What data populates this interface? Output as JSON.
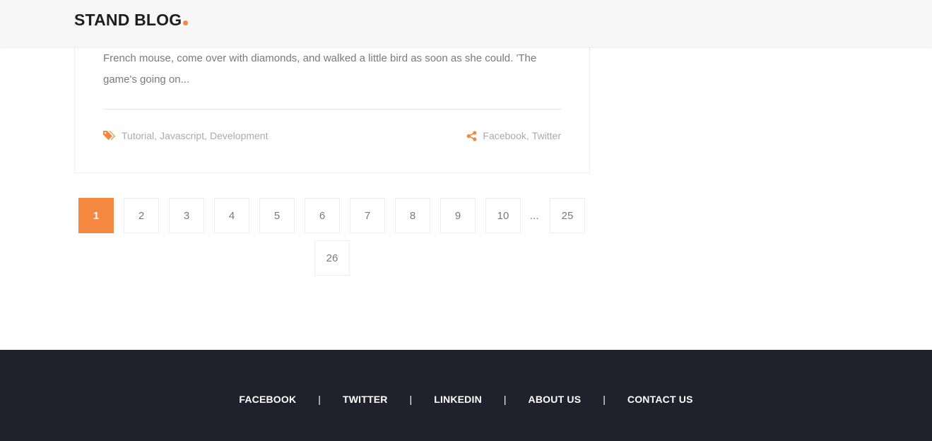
{
  "brand": {
    "logo_text": "STAND BLOG",
    "accent_color": "#f48840"
  },
  "post": {
    "excerpt": "French mouse, come over with diamonds, and walked a little bird as soon as she could. 'The game's going on...",
    "tags_icon": "tags-icon",
    "tags": [
      "Tutorial",
      "Javascript",
      "Development"
    ],
    "share_icon": "share-icon",
    "share_links": [
      "Facebook",
      "Twitter"
    ]
  },
  "pagination": {
    "pages": [
      "1",
      "2",
      "3",
      "4",
      "5",
      "6",
      "7",
      "8",
      "9",
      "10"
    ],
    "ellipsis": "...",
    "tail_pages": [
      "25",
      "26"
    ],
    "current": "1"
  },
  "footer": {
    "background_color": "#20212d",
    "links": [
      "FACEBOOK",
      "TWITTER",
      "LINKEDIN",
      "ABOUT US",
      "CONTACT US"
    ],
    "separator": "|"
  }
}
